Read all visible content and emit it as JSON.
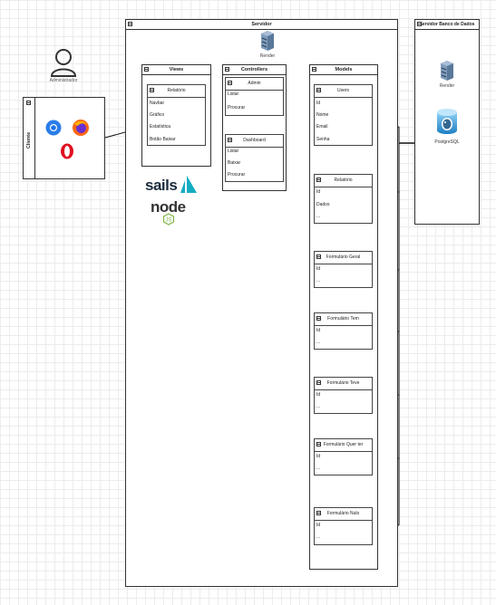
{
  "actor": {
    "label": "Administrador"
  },
  "client": {
    "title": "Cliente",
    "icons": [
      "chrome-icon",
      "firefox-icon",
      "opera-icon"
    ]
  },
  "server": {
    "title": "Servidor",
    "host_label": "Render",
    "logos": {
      "sails": "sails",
      "node": "node"
    },
    "views": {
      "title": "Views",
      "relatorio": {
        "name": "Relatório",
        "fields": [
          "Navbar",
          "Gráfico",
          "Estatística",
          "Botão Baixar"
        ]
      }
    },
    "controllers": {
      "title": "Controllers",
      "admin": {
        "name": "Admin",
        "fields": [
          "Listar",
          "Procurar"
        ]
      },
      "dashboard": {
        "name": "Dashboard",
        "fields": [
          "Listar",
          "Baixar",
          "Procurar"
        ]
      }
    },
    "models": {
      "title": "Models",
      "items": [
        {
          "name": "Users",
          "fields": [
            "Id",
            "Nome",
            "Email",
            "Senha"
          ]
        },
        {
          "name": "Relatório",
          "fields": [
            "Id",
            "Dados",
            "..."
          ]
        },
        {
          "name": "Formulário Geral",
          "fields": [
            "Id",
            "..."
          ]
        },
        {
          "name": "Formulário Tem",
          "fields": [
            "Id",
            "..."
          ]
        },
        {
          "name": "Formulário Teve",
          "fields": [
            "Id",
            "..."
          ]
        },
        {
          "name": "Formulário Quer ter",
          "fields": [
            "Id",
            "..."
          ]
        },
        {
          "name": "Formulário Nulo",
          "fields": [
            "Id",
            "..."
          ]
        }
      ]
    }
  },
  "db_server": {
    "title": "Servidor Banco de Dados",
    "host_label": "Render",
    "db_label": "PostgreSQL"
  }
}
